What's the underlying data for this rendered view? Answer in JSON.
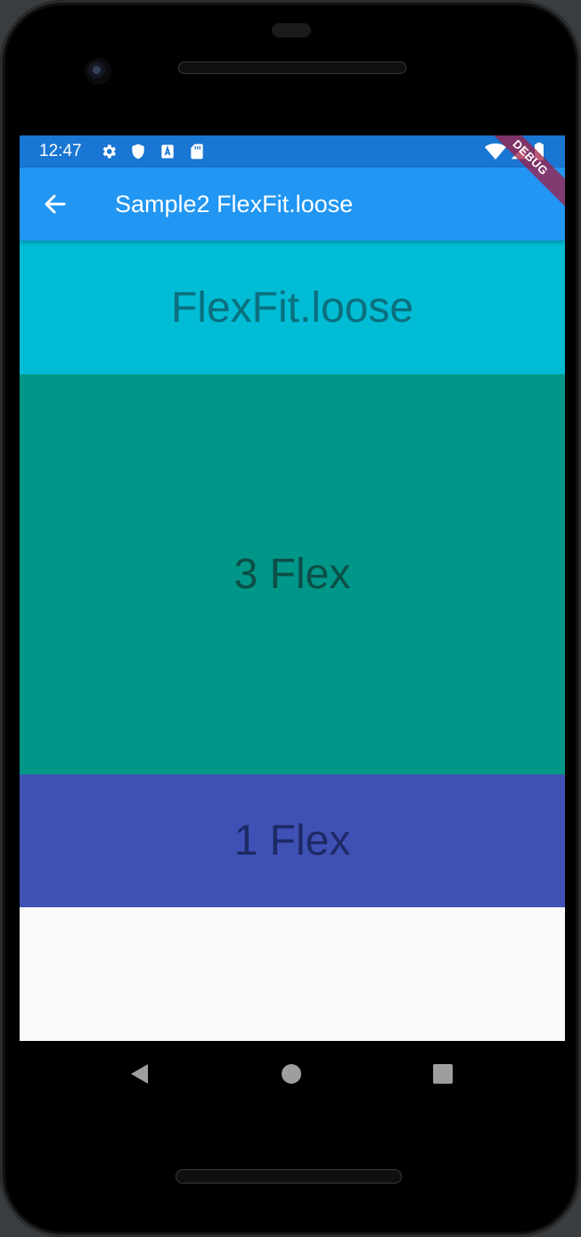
{
  "status_bar": {
    "time": "12:47",
    "left_icons": [
      "gear-icon",
      "shield-icon",
      "a-box-icon",
      "sd-card-icon"
    ],
    "right_icons": [
      "wifi-icon",
      "signal-icon",
      "battery-icon"
    ],
    "color": "#1976d2"
  },
  "app_bar": {
    "title": "Sample2 FlexFit.loose",
    "back_icon": "arrow-left-icon",
    "color": "#2196f3"
  },
  "debug_banner": {
    "label": "DEBUG"
  },
  "content": {
    "blocks": [
      {
        "label": "FlexFit.loose",
        "color": "#00bcd4"
      },
      {
        "label": "3 Flex",
        "color": "#009688"
      },
      {
        "label": "1 Flex",
        "color": "#3f51b5"
      }
    ],
    "background": "#fafafa"
  },
  "nav_bar": {
    "buttons": [
      "back-triangle-icon",
      "home-circle-icon",
      "recents-square-icon"
    ]
  }
}
